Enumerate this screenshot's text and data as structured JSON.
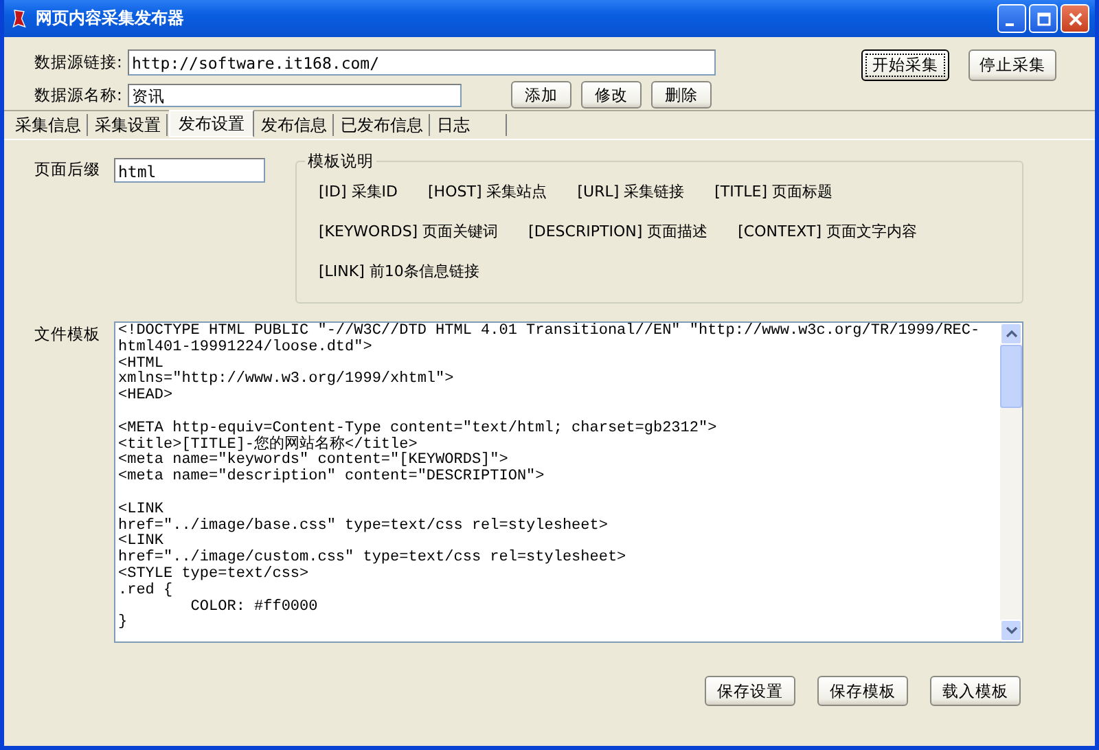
{
  "window": {
    "title": "网页内容采集发布器"
  },
  "source": {
    "url_label": "数据源链接:",
    "url_value": "http://software.it168.com/",
    "name_label": "数据源名称:",
    "name_value": "资讯",
    "buttons": [
      "添加",
      "修改",
      "删除"
    ]
  },
  "collect_buttons": [
    {
      "label": "开始采集",
      "focused": true
    },
    {
      "label": "停止采集",
      "focused": false
    }
  ],
  "tabs": [
    {
      "label": "采集信息",
      "selected": false
    },
    {
      "label": "采集设置",
      "selected": false
    },
    {
      "label": "发布设置",
      "selected": true
    },
    {
      "label": "发布信息",
      "selected": false
    },
    {
      "label": "已发布信息",
      "selected": false
    },
    {
      "label": "日志",
      "selected": false
    }
  ],
  "suffix": {
    "label": "页面后缀",
    "value": "html"
  },
  "template_help": {
    "title": "模板说明",
    "lines": [
      {
        "entries": [
          "[ID] 采集ID",
          "[HOST] 采集站点",
          "[URL] 采集链接",
          "[TITLE] 页面标题"
        ]
      },
      {
        "entries": [
          "[KEYWORDS] 页面关键词",
          "[DESCRIPTION] 页面描述",
          "[CONTEXT] 页面文字内容"
        ]
      },
      {
        "entries": [
          "[LINK] 前10条信息链接"
        ]
      }
    ]
  },
  "file_template": {
    "label": "文件模板",
    "blocks": [
      [
        "<!DOCTYPE HTML PUBLIC \"-//W3C//DTD HTML 4.01 Transitional//EN\" \"http://www.w3c.org/TR/1999/REC-",
        "html401-19991224/loose.dtd\">",
        "<HTML",
        "xmlns=\"http://www.w3.org/1999/xhtml\">",
        "<HEAD>"
      ],
      [
        "<META http-equiv=Content-Type content=\"text/html; charset=gb2312\">",
        "<title>[TITLE]-您的网站名称</title>",
        "<meta name=\"keywords\" content=\"[KEYWORDS]\">",
        "<meta name=\"description\" content=\"DESCRIPTION\">"
      ],
      [
        "<LINK",
        "href=\"../image/base.css\" type=text/css rel=stylesheet>",
        "<LINK",
        "href=\"../image/custom.css\" type=text/css rel=stylesheet>",
        "<STYLE type=text/css>",
        ".red {",
        "        COLOR: #ff0000",
        "}"
      ]
    ]
  },
  "bottom_buttons": [
    "保存设置",
    "保存模板",
    "载入模板"
  ]
}
